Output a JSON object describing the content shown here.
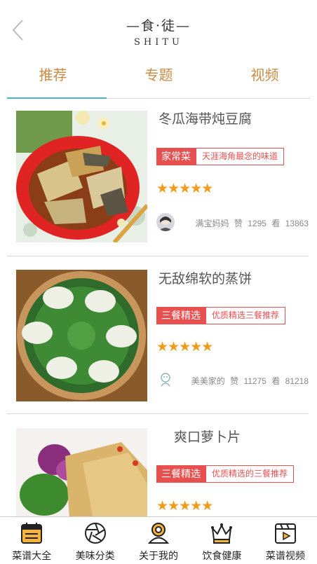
{
  "header": {
    "back_icon": "chevron-left-icon",
    "logo_cn": "—食·徒—",
    "logo_en": "SHITU"
  },
  "tabs": [
    {
      "label": "推荐",
      "active": true
    },
    {
      "label": "专题",
      "active": false
    },
    {
      "label": "视频",
      "active": false
    }
  ],
  "accent_colors": {
    "tab_text": "#c98a45",
    "indicator": "#4bb2c9",
    "tag": "#e85050",
    "star": "#f39a17"
  },
  "recipes": [
    {
      "title": "冬瓜海带炖豆腐",
      "tag": "家常菜",
      "subtag": "天涯海角最念的味道",
      "rating": "★★★★★",
      "stars_filled": 5,
      "author": "满宝妈妈",
      "likes_label": "赞",
      "likes": "1295",
      "views_label": "看",
      "views": "13863"
    },
    {
      "title": "无敌绵软的蒸饼",
      "tag": "三餐精选",
      "subtag": "优质精选三餐推荐",
      "rating": "★★★★★",
      "stars_filled": 5,
      "author": "美美家的",
      "likes_label": "赞",
      "likes": "11275",
      "views_label": "看",
      "views": "81218"
    },
    {
      "title": "爽口萝卜片",
      "tag": "三餐精选",
      "subtag": "优质精选的三餐推荐",
      "rating": "★★★★★",
      "stars_filled": 5
    }
  ],
  "bottom_nav": [
    {
      "label": "菜谱大全",
      "icon": "calendar-icon"
    },
    {
      "label": "美味分类",
      "icon": "aperture-icon"
    },
    {
      "label": "关于我的",
      "icon": "user-icon"
    },
    {
      "label": "饮食健康",
      "icon": "crown-icon"
    },
    {
      "label": "菜谱视频",
      "icon": "video-icon"
    }
  ]
}
